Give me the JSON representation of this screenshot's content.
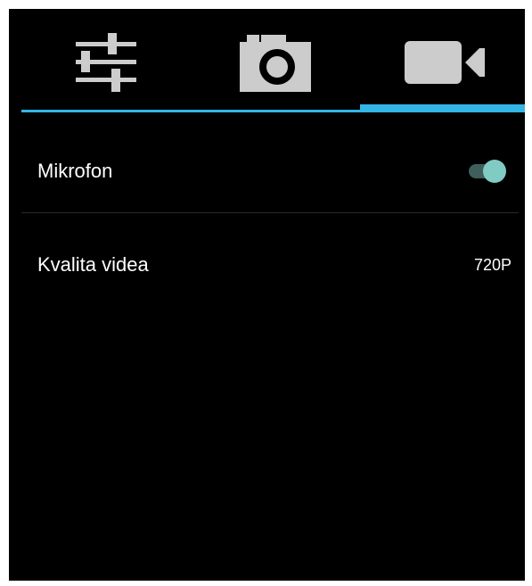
{
  "tabs": [
    {
      "icon": "sliders-icon",
      "selected": false
    },
    {
      "icon": "camera-icon",
      "selected": false
    },
    {
      "icon": "video-camera-icon",
      "selected": true
    }
  ],
  "settings": {
    "microphone": {
      "label": "Mikrofon",
      "enabled": true
    },
    "video_quality": {
      "label": "Kvalita videa",
      "value": "720P"
    }
  },
  "colors": {
    "background": "#000000",
    "accent": "#33b5e5",
    "toggle_thumb": "#80cbc4",
    "toggle_track": "#3f5f5c",
    "icon": "#cccccc",
    "text": "#ffffff"
  }
}
